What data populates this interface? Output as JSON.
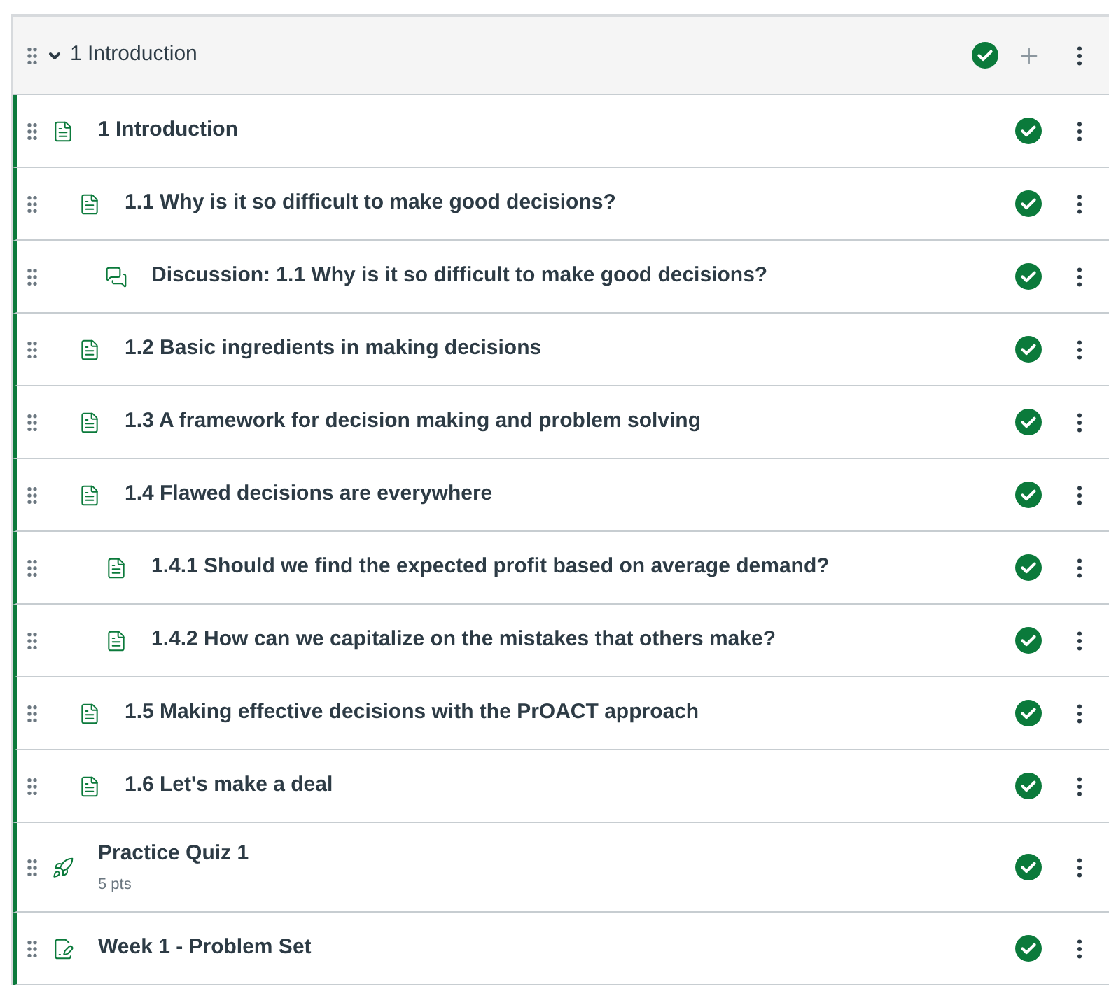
{
  "module": {
    "title": "1 Introduction",
    "expanded": true,
    "published": true
  },
  "items": [
    {
      "kind": "page",
      "title": "1 Introduction",
      "published": true,
      "children": [
        {
          "kind": "page",
          "title": "1.1 Why is it so difficult to make good decisions?",
          "published": true,
          "children": [
            {
              "kind": "discussion",
              "title": "Discussion: 1.1 Why is it so difficult to make good decisions?",
              "published": true
            }
          ]
        },
        {
          "kind": "page",
          "title": "1.2 Basic ingredients in making decisions",
          "published": true
        },
        {
          "kind": "page",
          "title": "1.3 A framework for decision making and problem solving",
          "published": true
        },
        {
          "kind": "page",
          "title": "1.4 Flawed decisions are everywhere",
          "published": true,
          "children": [
            {
              "kind": "page",
              "title": "1.4.1 Should we find the expected profit based on average demand?",
              "published": true
            },
            {
              "kind": "page",
              "title": "1.4.2 How can we capitalize on the mistakes that others make?",
              "published": true
            }
          ]
        },
        {
          "kind": "page",
          "title": "1.5 Making effective decisions with the PrOACT approach",
          "published": true
        },
        {
          "kind": "page",
          "title": "1.6 Let's make a deal",
          "published": true
        }
      ]
    },
    {
      "kind": "quiz",
      "title": "Practice Quiz 1",
      "points": "5 pts",
      "published": true
    },
    {
      "kind": "assignment",
      "title": "Week 1 - Problem Set",
      "published": true
    }
  ]
}
